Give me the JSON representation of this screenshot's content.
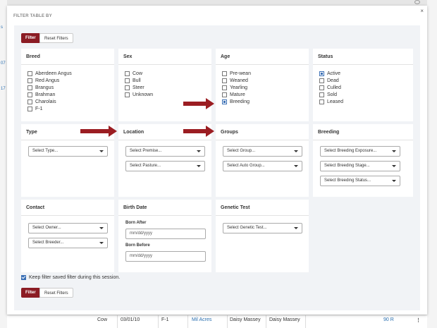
{
  "background": {
    "left_snippets": [
      "s",
      "07",
      "17"
    ],
    "row": {
      "cells": [
        "Cow",
        "03/01/10",
        "F-1",
        "Mil Acres",
        "Daisy Massey",
        "Daisy Massey",
        "90 R"
      ]
    }
  },
  "modal": {
    "title": "FILTER TABLE BY",
    "close": "×",
    "filter_label": "Filter",
    "reset_label": "Reset Filters",
    "breed": {
      "heading": "Breed",
      "options": [
        {
          "label": "Aberdeen Angus",
          "checked": false
        },
        {
          "label": "Red Angus",
          "checked": false
        },
        {
          "label": "Brangus",
          "checked": false
        },
        {
          "label": "Brahman",
          "checked": false
        },
        {
          "label": "Charolais",
          "checked": false
        },
        {
          "label": "F-1",
          "checked": false
        }
      ]
    },
    "sex": {
      "heading": "Sex",
      "options": [
        {
          "label": "Cow",
          "checked": false
        },
        {
          "label": "Bull",
          "checked": false
        },
        {
          "label": "Steer",
          "checked": false
        },
        {
          "label": "Unknown",
          "checked": false
        }
      ]
    },
    "age": {
      "heading": "Age",
      "options": [
        {
          "label": "Pre-wean",
          "checked": false
        },
        {
          "label": "Weaned",
          "checked": false
        },
        {
          "label": "Yearling",
          "checked": false
        },
        {
          "label": "Mature",
          "checked": false
        },
        {
          "label": "Breeding",
          "checked": true
        }
      ]
    },
    "status": {
      "heading": "Status",
      "options": [
        {
          "label": "Active",
          "checked": true
        },
        {
          "label": "Dead",
          "checked": false
        },
        {
          "label": "Culled",
          "checked": false
        },
        {
          "label": "Sold",
          "checked": false
        },
        {
          "label": "Leased",
          "checked": false
        }
      ]
    },
    "type": {
      "heading": "Type",
      "select": "Select Type..."
    },
    "location": {
      "heading": "Location",
      "premise": "Select Premise...",
      "pasture": "Select Pasture..."
    },
    "groups": {
      "heading": "Groups",
      "group": "Select Group...",
      "auto_group": "Select Auto Group..."
    },
    "breeding": {
      "heading": "Breeding",
      "exposure": "Select Breeding Exposure...",
      "stage": "Select Breeding Stage...",
      "status": "Select Breeding Status..."
    },
    "contact": {
      "heading": "Contact",
      "owner": "Select Owner...",
      "breeder": "Select Breeder..."
    },
    "birth_date": {
      "heading": "Birth Date",
      "born_after": "Born After",
      "born_before": "Born Before",
      "placeholder": "mm/dd/yyyy"
    },
    "genetic_test": {
      "heading": "Genetic Test",
      "select": "Select Genetic Test..."
    },
    "keep_label": "Keep filter saved filter during this session.",
    "keep_checked": true
  }
}
